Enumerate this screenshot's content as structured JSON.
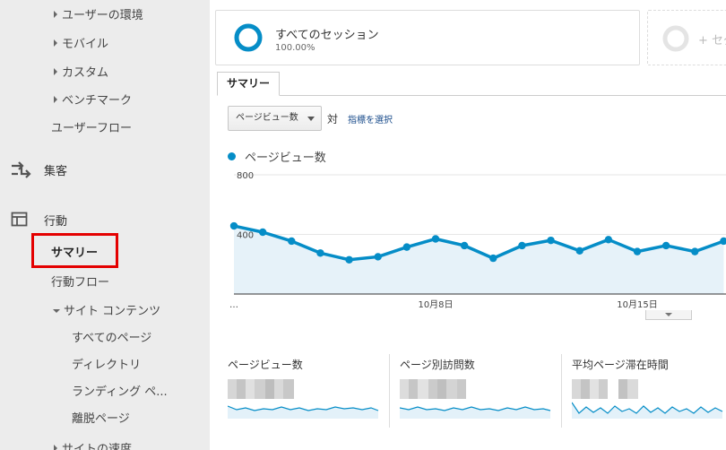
{
  "sidebar": {
    "items": [
      {
        "label": "ユーザーの環境",
        "arrow": "right"
      },
      {
        "label": "モバイル",
        "arrow": "right"
      },
      {
        "label": "カスタム",
        "arrow": "right"
      },
      {
        "label": "ベンチマーク",
        "arrow": "right"
      },
      {
        "label": "ユーザーフロー",
        "arrow": "none"
      }
    ],
    "acquisition": {
      "label": "集客",
      "icon": "acquisition-arrows-icon"
    },
    "behavior": {
      "label": "行動",
      "icon": "behavior-layout-icon"
    },
    "behavior_items": {
      "summary": "サマリー",
      "flow": "行動フロー",
      "site_content": "サイト コンテンツ",
      "all_pages": "すべてのページ",
      "directory": "ディレクトリ",
      "landing": "ランディング ペ...",
      "exit": "離脱ページ",
      "site_speed": "サイトの速度"
    },
    "highlight_color": "#e40000"
  },
  "segment": {
    "title": "すべてのセッション",
    "percent": "100.00%",
    "add_label": "+ セグ",
    "ring_color": "#058dc7"
  },
  "tabs": {
    "summary": "サマリー"
  },
  "controls": {
    "metric_select": "ページビュー数",
    "vs": "対",
    "pick_metric": "指標を選択"
  },
  "chart_data": {
    "type": "area",
    "series": [
      {
        "name": "ページビュー数",
        "color": "#058dc7",
        "values": [
          457,
          415,
          355,
          275,
          230,
          250,
          315,
          370,
          325,
          240,
          325,
          360,
          290,
          365,
          285,
          325,
          285,
          355
        ]
      }
    ],
    "yticks": [
      400,
      800
    ],
    "ylim": [
      0,
      800
    ],
    "xticks": [
      {
        "label": "…",
        "index": 0
      },
      {
        "label": "10月8日",
        "index": 7
      },
      {
        "label": "10月15日",
        "index": 14
      }
    ]
  },
  "sparklines": [
    {
      "title": "ページビュー数"
    },
    {
      "title": "ページ別訪問数"
    },
    {
      "title": "平均ページ滞在時間"
    }
  ]
}
